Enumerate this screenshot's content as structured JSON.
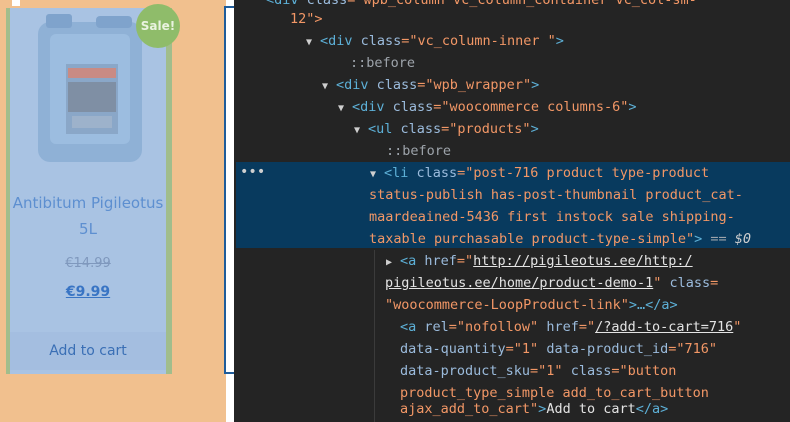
{
  "page": {
    "sale_badge": "Sale!",
    "product_title": "Antibitum Pigileotus 5L",
    "price_old": "€14.99",
    "price_new": "€9.99",
    "add_to_cart": "Add to cart",
    "image_icon": "jerrycan-image"
  },
  "devtools": {
    "lines": {
      "l0_a": "<div ",
      "l0_b": "class",
      "l0_c": "=\"wpb_column vc_column_container vc_col-sm-",
      "l1": "12\">",
      "l2_tag": "<div ",
      "l2_attr": "class",
      "l2_val": "=\"vc_column-inner \"",
      "l2_end": ">",
      "l3": "::before",
      "l4_tag": "<div ",
      "l4_attr": "class",
      "l4_val": "=\"wpb_wrapper\"",
      "l4_end": ">",
      "l5_tag": "<div ",
      "l5_attr": "class",
      "l5_val": "=\"woocommerce columns-6\"",
      "l5_end": ">",
      "l6_tag": "<ul ",
      "l6_attr": "class",
      "l6_val": "=\"products\"",
      "l6_end": ">",
      "l7": "::before",
      "l8_tag": "<li ",
      "l8_attr": "class",
      "l8_val": "=\"post-716 product type-product",
      "l9": "status-publish has-post-thumbnail product_cat-",
      "l10": "maardeained-5436 first instock sale shipping-",
      "l11": "taxable purchasable product-type-simple\"",
      "l11_end": ">",
      "l11_eq": " == ",
      "l11_dollar": "$0",
      "l12_tag": "<a ",
      "l12_attr": "href",
      "l12_eq": "=\"",
      "l12_link": "http://pigileotus.ee/http:/",
      "l13_link": "pigileotus.ee/home/product-demo-1",
      "l13_q": "\" ",
      "l13_attr": "class",
      "l13_eq": "=",
      "l14_val": "\"woocommerce-LoopProduct-link\"",
      "l14_end": ">…</a>",
      "l15_tag": "<a ",
      "l15_attr1": "rel",
      "l15_val1": "=\"nofollow\" ",
      "l15_attr2": "href",
      "l15_eq": "=\"",
      "l15_link": "/?add-to-cart=716",
      "l15_q": "\"",
      "l16_attr1": "data-quantity",
      "l16_val1": "=\"1\" ",
      "l16_attr2": "data-product_id",
      "l16_val2": "=\"716\"",
      "l17_attr1": "data-product_sku",
      "l17_val1": "=\"1\" ",
      "l17_attr2": "class",
      "l17_val2": "=\"button",
      "l18": "product_type_simple add_to_cart_button",
      "l19_val": "ajax_add_to_cart\"",
      "l19_gt": ">",
      "l19_text": "Add to cart",
      "l19_end": "</a>",
      "ellipsis": "•••"
    }
  },
  "colors": {
    "margin_orange": "#f1c08e",
    "padding_green": "#a1bd8c",
    "content_blue": "#a9c3e3",
    "selected_row": "#083a5e",
    "tag": "#5db0d7",
    "attr_value": "#f29766"
  }
}
